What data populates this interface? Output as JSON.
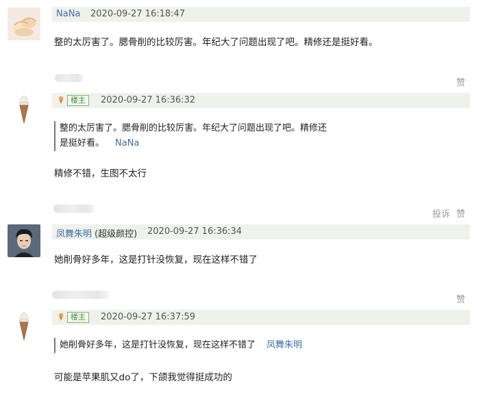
{
  "comments": [
    {
      "username": "NaNa",
      "timestamp": "2020-09-27 16:18:47",
      "text": "整的太厉害了。腮骨削的比较厉害。年纪大了问题出现了吧。精修还是挺好看。"
    },
    {
      "badge": "楼主",
      "timestamp": "2020-09-27 16:36:32",
      "quote_line1": "整的太厉害了。腮骨削的比较厉害。年纪大了问题出现了吧。精修还",
      "quote_line2": "是挺好看。",
      "quote_author": "NaNa",
      "text": "精修不错，生图不太行"
    },
    {
      "username": "凤舞朱明",
      "user_tag": "(超级颜控)",
      "timestamp": "2020-09-27 16:36:34",
      "text": "她削骨好多年，这是打针没恢复，现在这样不错了"
    },
    {
      "badge": "楼主",
      "timestamp": "2020-09-27 16:37:59",
      "quote_line1": "她削骨好多年，这是打针没恢复，现在这样不错了",
      "quote_author": "凤舞朱明",
      "text": "可能是苹果肌又do了，下颌我觉得挺成功的"
    }
  ],
  "actions": {
    "like": "赞",
    "report": "投诉"
  }
}
